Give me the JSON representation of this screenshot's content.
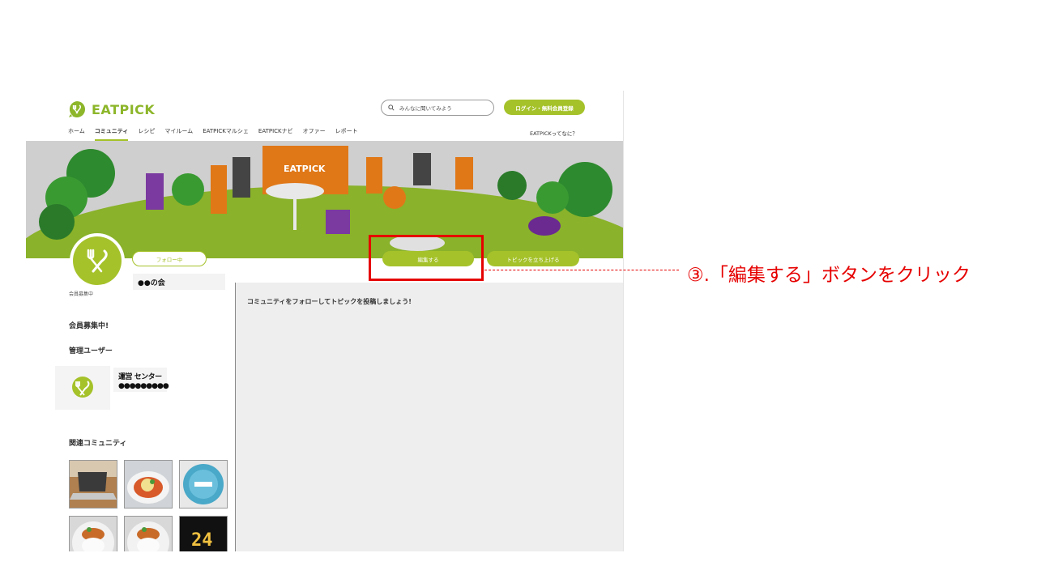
{
  "header": {
    "logo_text": "EATPICK",
    "search_placeholder": "みんなに聞いてみよう",
    "login_button": "ログイン・無料会員登録",
    "about_link": "EATPICKってなに？"
  },
  "nav": {
    "items": [
      "ホーム",
      "コミュニティ",
      "レシピ",
      "マイルーム",
      "EATPICKマルシェ",
      "EATPICKナビ",
      "オファー",
      "レポート"
    ],
    "active": "コミュニティ"
  },
  "banner": {
    "sign_text": "EATPICK"
  },
  "community": {
    "follow_button": "フォロー中",
    "edit_button": "編集する",
    "topic_button": "トピックを立ち上げる",
    "name": "●●の会",
    "recruit_small": "会員募集中"
  },
  "main": {
    "message": "コミュニティをフォローしてトピックを投稿しましょう!"
  },
  "sidebar": {
    "recruit_heading": "会員募集中!",
    "admin_heading": "管理ユーザー",
    "admin_name": "運営 センター",
    "admin_sub": "●●●●●●●●●",
    "related_heading": "関連コミュニティ",
    "related": [
      {
        "icon": "laptop-photo"
      },
      {
        "icon": "dish-photo"
      },
      {
        "icon": "plate-photo"
      },
      {
        "icon": "curry-photo"
      },
      {
        "icon": "curry-photo"
      },
      {
        "icon": "number-24-photo",
        "label": "24"
      }
    ]
  },
  "annotation": {
    "text": "③.「編集する」ボタンをクリック",
    "color": "#e60000"
  },
  "colors": {
    "brand": "#a5c22a",
    "logo": "#8db62a"
  }
}
